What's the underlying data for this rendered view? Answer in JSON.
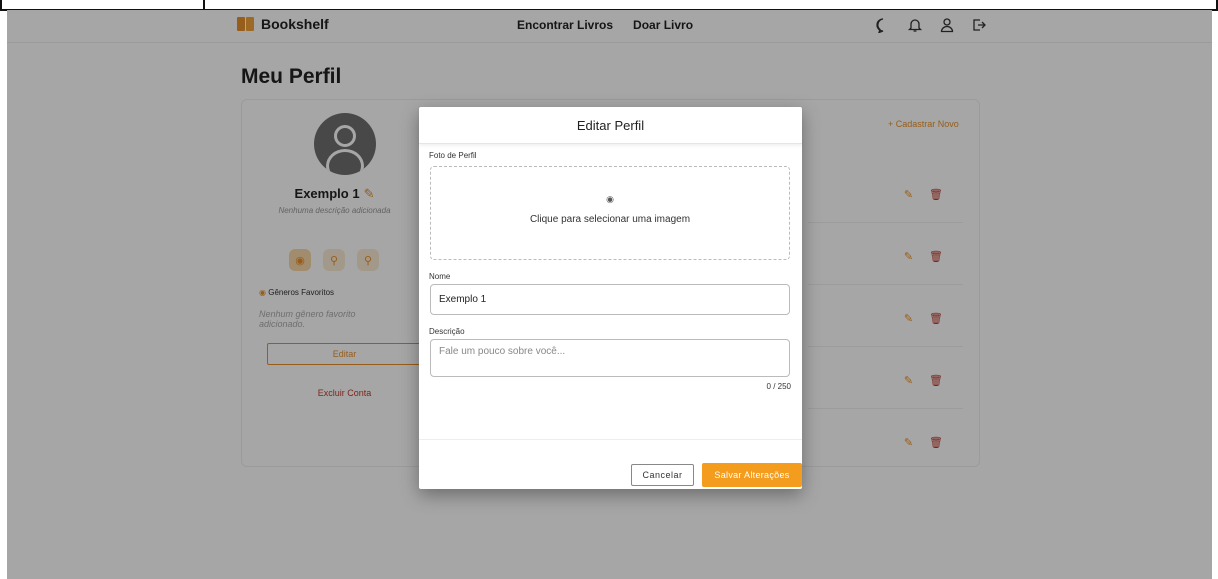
{
  "header": {
    "brand": "Bookshelf",
    "nav": [
      "Encontrar Livros",
      "Doar Livro"
    ],
    "icons": [
      "chat-icon",
      "bell-icon",
      "user-icon",
      "logout-icon"
    ]
  },
  "page": {
    "title": "Meu Perfil"
  },
  "profile": {
    "name": "Exemplo 1",
    "description": "Nenhuma descrição adicionada",
    "genres_label": "Gêneros Favoritos",
    "genres_empty": "Nenhum gênero favorito adicionado.",
    "edit_label": "Editar",
    "delete_account_label": "Excluir Conta"
  },
  "books": {
    "add_new_label": "+ Cadastrar Novo",
    "row_count": 5
  },
  "modal": {
    "title": "Editar Perfil",
    "photo_label": "Foto de Perfil",
    "photo_prompt": "Clique para selecionar uma imagem",
    "name_label": "Nome",
    "name_value": "Exemplo 1",
    "desc_label": "Descrição",
    "desc_placeholder": "Fale um pouco sobre você...",
    "counter": "0 / 250",
    "cancel_label": "Cancelar",
    "save_label": "Salvar Alterações"
  },
  "colors": {
    "accent": "#f39c1e",
    "danger": "#c0392b"
  }
}
